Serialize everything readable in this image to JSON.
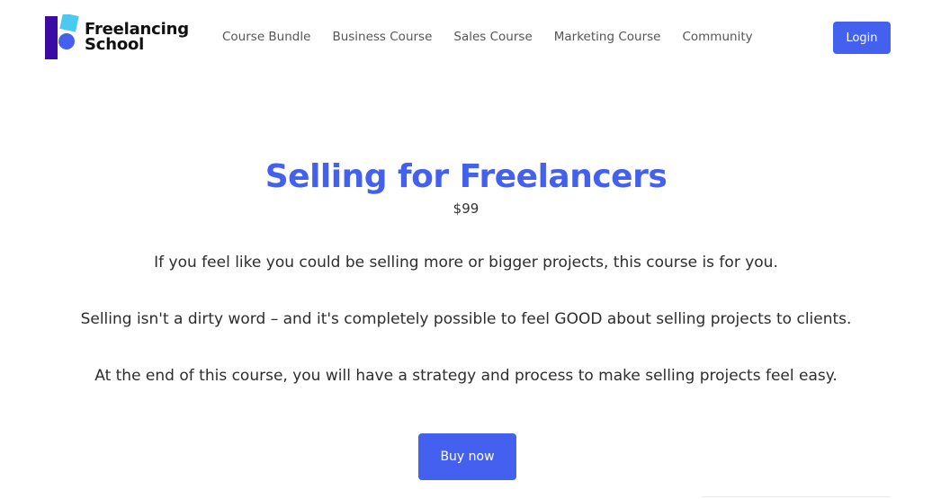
{
  "brand": {
    "line1": "Freelancing",
    "line2": "School"
  },
  "nav": [
    {
      "label": "Course Bundle"
    },
    {
      "label": "Business Course"
    },
    {
      "label": "Sales Course"
    },
    {
      "label": "Marketing Course"
    },
    {
      "label": "Community"
    }
  ],
  "header": {
    "login_label": "Login"
  },
  "course": {
    "title": "Selling for Freelancers",
    "price": "$99",
    "paragraphs": [
      "If you feel like you could be selling more or bigger projects, this course is for you.",
      "Selling isn't a dirty word – and it's completely possible to feel GOOD about selling projects to clients.",
      "At the end of this course, you will have a strategy and process to make selling projects feel easy."
    ],
    "buy_label": "Buy now"
  },
  "colors": {
    "accent": "#4361ee",
    "logo_dark": "#3a0ca3",
    "logo_light": "#4cc9f0"
  }
}
